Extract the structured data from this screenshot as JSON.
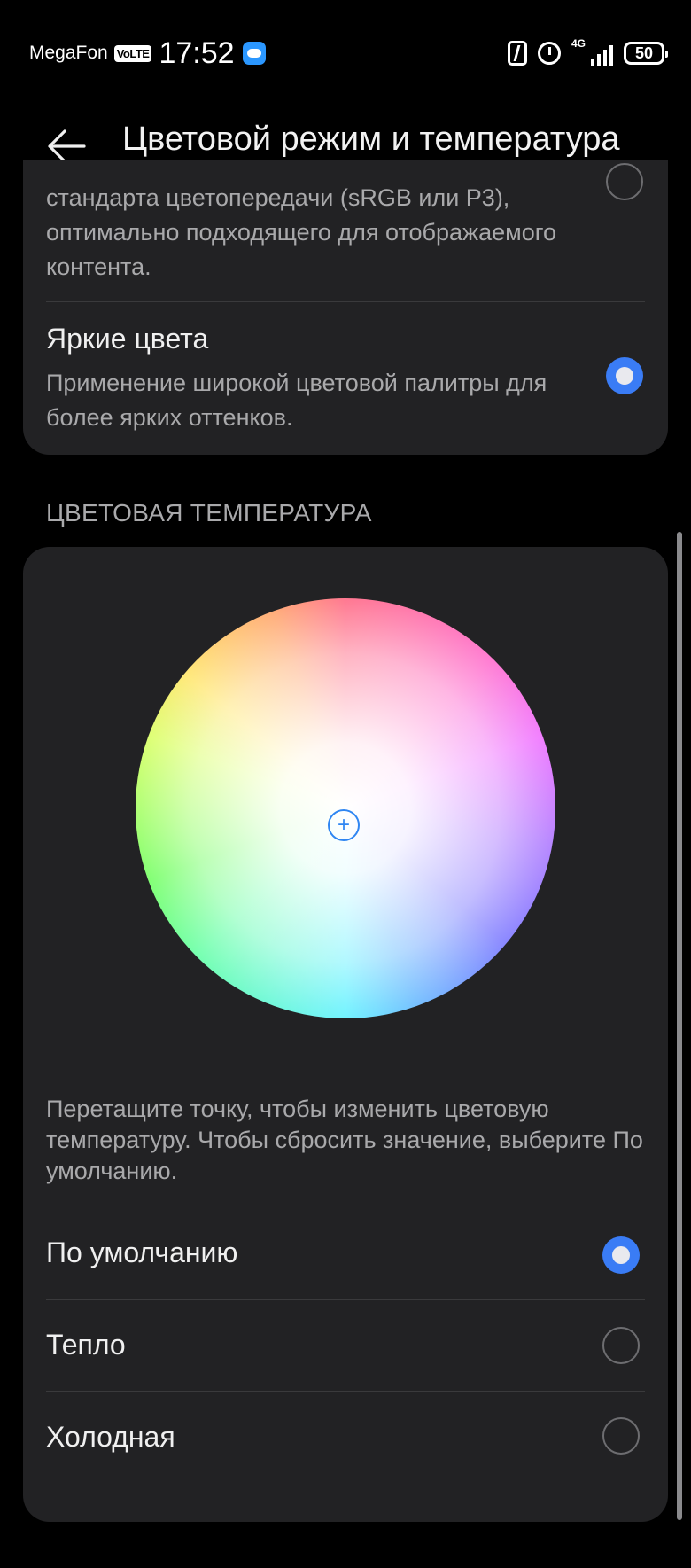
{
  "status_bar": {
    "carrier": "MegaFon",
    "volte": "VoLTE",
    "time": "17:52",
    "network": "4G",
    "battery": "50",
    "icons": [
      "cloud-icon",
      "nfc-icon",
      "alarm-icon",
      "signal-icon",
      "battery-icon"
    ]
  },
  "header": {
    "title": "Цветовой режим и температура",
    "back_icon": "arrow-left-icon"
  },
  "color_mode": {
    "normal_desc": "стандарта цветопередачи (sRGB или P3), оптимально подходящего для отображаемого контента.",
    "vivid_title": "Яркие цвета",
    "vivid_desc": "Применение широкой цветовой палитры для более ярких оттенков.",
    "selected": "vivid"
  },
  "color_temperature": {
    "section_title": "ЦВЕТОВАЯ ТЕМПЕРАТУРА",
    "hint": "Перетащите точку, чтобы изменить цветовую температуру. Чтобы сбросить значение, выберите По умолчанию.",
    "options": [
      {
        "label": "По умолчанию",
        "selected": true
      },
      {
        "label": "Тепло",
        "selected": false
      },
      {
        "label": "Холодная",
        "selected": false
      }
    ]
  },
  "colors": {
    "accent": "#3a7cf5",
    "card": "#222224",
    "background": "#000000",
    "secondary_text": "#a9a9ab"
  }
}
